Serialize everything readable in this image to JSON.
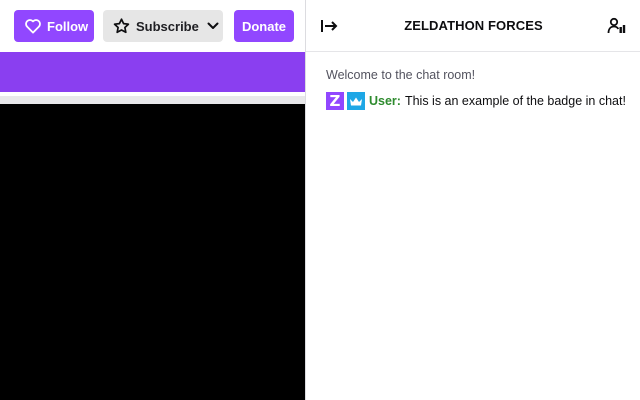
{
  "topbar": {
    "follow_label": "Follow",
    "subscribe_label": "Subscribe",
    "donate_label": "Donate",
    "follow_icon": "heart-outline-icon",
    "subscribe_icon": "star-outline-icon",
    "subscribe_menu_icon": "chevron-down-icon"
  },
  "chat": {
    "title": "ZELDATHON FORCES",
    "collapse_icon": "collapse-right-arrow-icon",
    "users_icon": "community-users-icon",
    "welcome": "Welcome to the chat room!",
    "messages": [
      {
        "badges": [
          {
            "name": "zeldathon-z-badge",
            "text": "Z",
            "color": "#9147ff"
          },
          {
            "name": "crown-badge",
            "color": "#1ea7e6"
          }
        ],
        "username": "User",
        "username_color": "#2e8b2e",
        "text": "This is an example of the badge in chat!"
      }
    ]
  },
  "colors": {
    "accent": "#9147ff",
    "banner": "#8a3ff0",
    "video_background": "#000000",
    "subscribe_button_bg": "#e6e6e6"
  }
}
